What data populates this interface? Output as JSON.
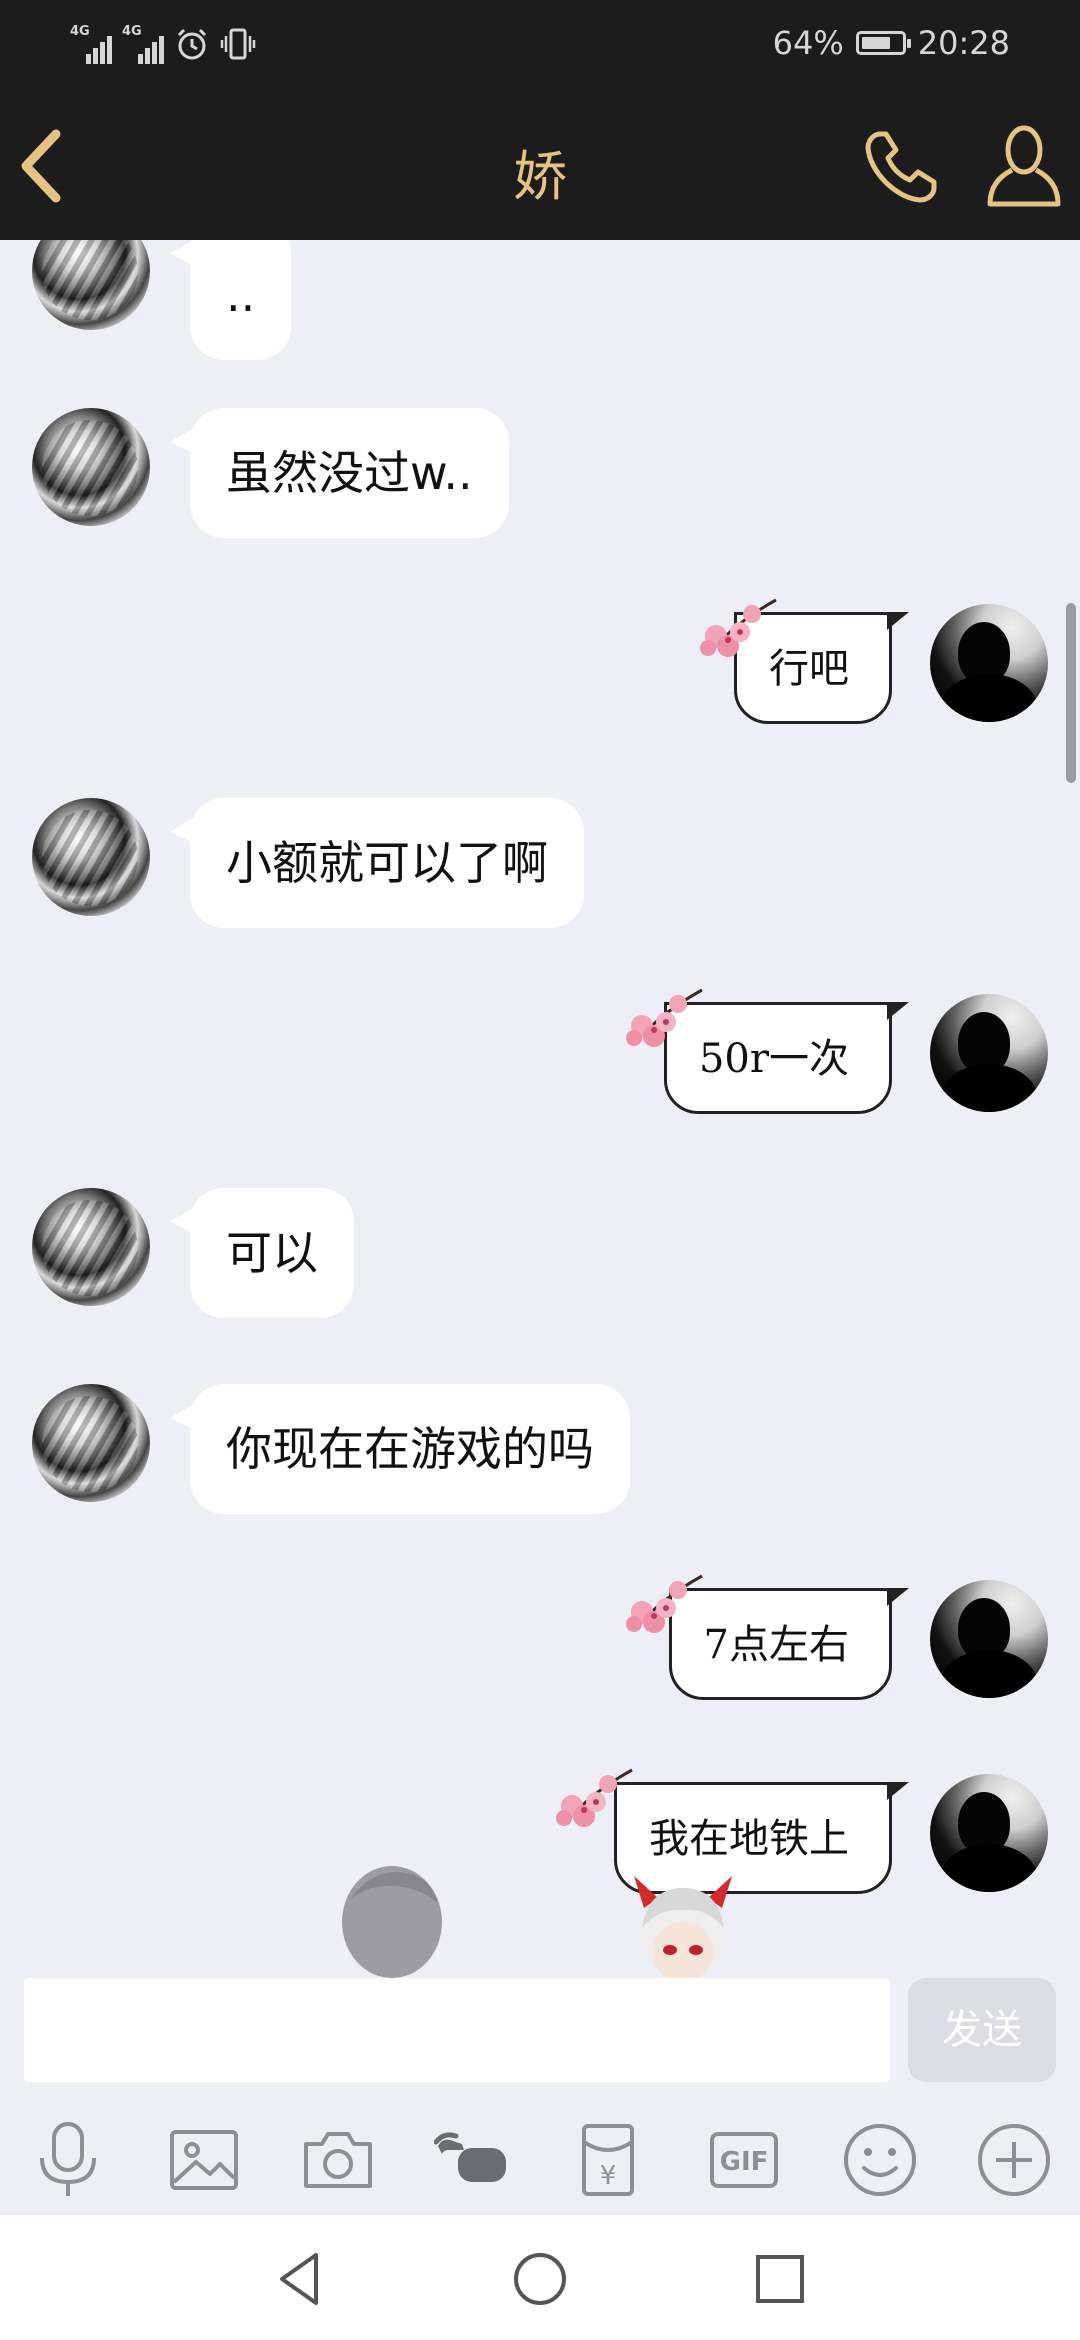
{
  "status_bar": {
    "network_1": "4G",
    "network_2": "4G",
    "battery": "64%",
    "time": "20:28"
  },
  "header": {
    "title": "娇"
  },
  "messages": [
    {
      "side": "left",
      "text": ".."
    },
    {
      "side": "left",
      "text": "虽然没过w.."
    },
    {
      "side": "right",
      "text": "行吧"
    },
    {
      "side": "left",
      "text": "小额就可以了啊"
    },
    {
      "side": "right",
      "text": "50r一次"
    },
    {
      "side": "left",
      "text": "可以"
    },
    {
      "side": "left",
      "text": "你现在在游戏的吗"
    },
    {
      "side": "right",
      "text": "7点左右"
    },
    {
      "side": "right",
      "text": "我在地铁上"
    }
  ],
  "input": {
    "value": "",
    "send_label": "发送"
  },
  "toolbar": {
    "icons": [
      "microphone-icon",
      "image-icon",
      "camera-icon",
      "poke-hand-icon",
      "red-packet-icon",
      "gif-icon",
      "emoji-icon",
      "plus-icon"
    ],
    "gif_label": "GIF",
    "red_packet_label": "¥"
  },
  "colors": {
    "header_bg": "#1c1c1c",
    "accent_gold": "#e6c37f",
    "chat_bg": "#eeeef6",
    "icon_gray": "#8e8e96"
  }
}
